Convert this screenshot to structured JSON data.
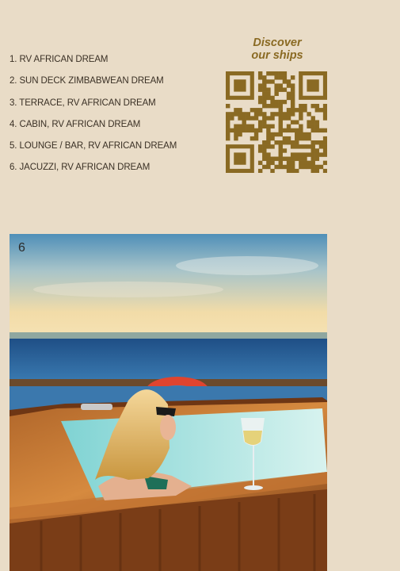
{
  "captions": [
    "1. RV AFRICAN DREAM",
    "2. SUN DECK ZIMBABWEAN DREAM",
    "3. TERRACE, RV AFRICAN DREAM",
    "4. CABIN, RV AFRICAN DREAM",
    "5. LOUNGE / BAR, RV AFRICAN DREAM",
    "6. JACUZZI, RV AFRICAN DREAM"
  ],
  "promo": {
    "line1": "Discover",
    "line2": "our ships"
  },
  "photo": {
    "number": "6"
  },
  "colors": {
    "background": "#e9dcc7",
    "accent": "#8a6a23",
    "text": "#3a3025"
  }
}
